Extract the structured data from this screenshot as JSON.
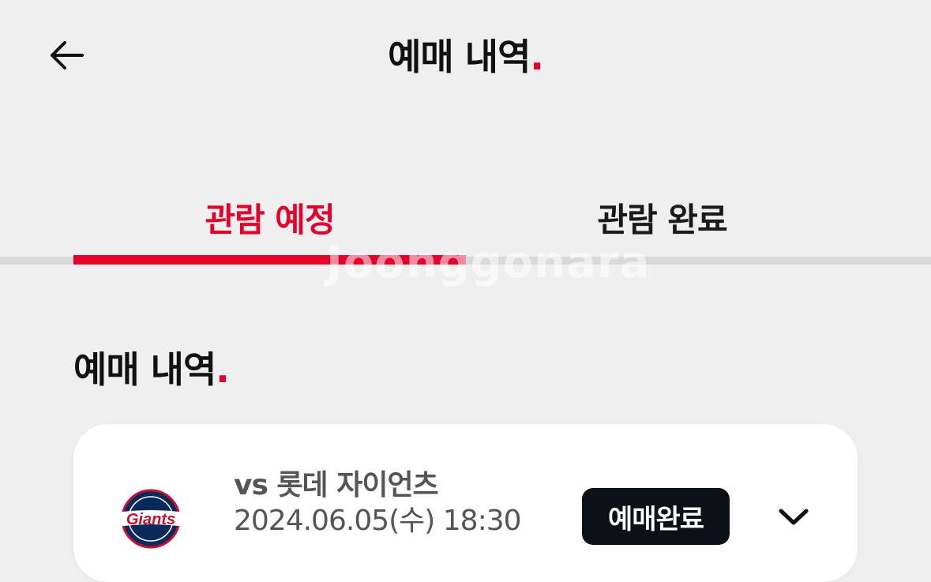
{
  "header": {
    "title": "예매 내역",
    "title_dot": ".",
    "back_icon": "arrow-left-icon"
  },
  "tabs": [
    {
      "label": "관람 예정",
      "active": true
    },
    {
      "label": "관람 완료",
      "active": false
    }
  ],
  "watermark": "Joonggonara",
  "section": {
    "title": "예매 내역",
    "title_dot": "."
  },
  "booking": {
    "team_logo": "giants-logo",
    "team_logo_text": "Giants",
    "opponent": "vs 롯데 자이언츠",
    "datetime": "2024.06.05(수) 18:30",
    "status": "예매완료",
    "expand_icon": "chevron-down-icon"
  },
  "colors": {
    "accent": "#e4002b",
    "background": "#efefef",
    "card": "#ffffff",
    "badge": "#0c1117"
  }
}
